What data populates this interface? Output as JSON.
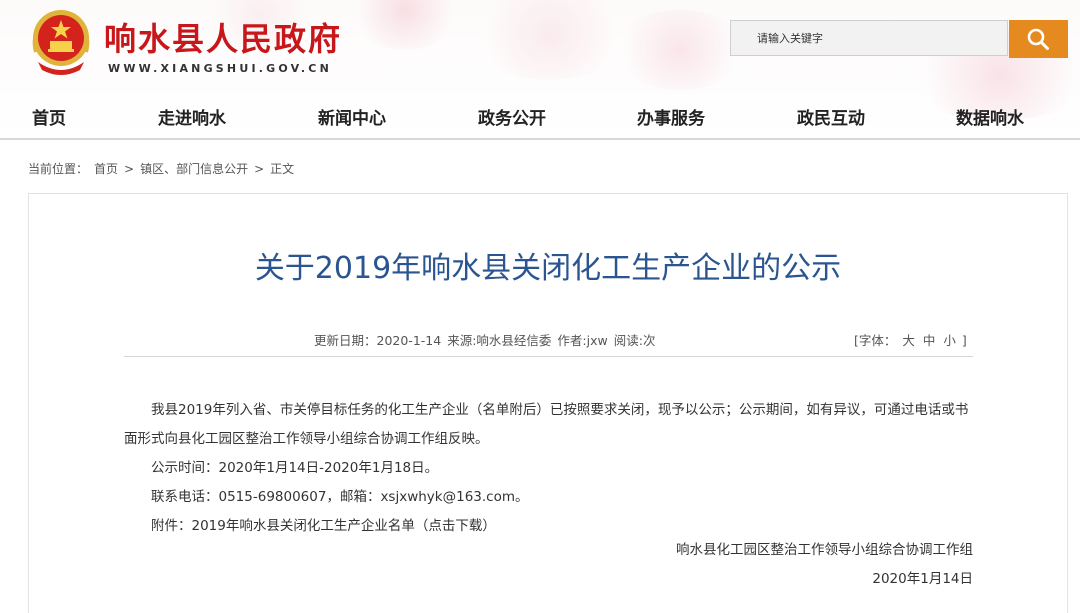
{
  "header": {
    "site_title": "响水县人民政府",
    "site_url": "WWW.XIANGSHUI.GOV.CN",
    "emblem_icon": "national-emblem-icon",
    "search": {
      "placeholder": "请输入关键字",
      "button_icon": "search-icon",
      "button_color": "#e58a1f"
    }
  },
  "nav": {
    "items": [
      {
        "label": "首页"
      },
      {
        "label": "走进响水"
      },
      {
        "label": "新闻中心"
      },
      {
        "label": "政务公开"
      },
      {
        "label": "办事服务"
      },
      {
        "label": "政民互动"
      },
      {
        "label": "数据响水"
      }
    ]
  },
  "breadcrumb": {
    "prefix": "当前位置：",
    "items": [
      "首页",
      "镇区、部门信息公开",
      "正文"
    ],
    "separator": ">"
  },
  "article": {
    "title": "关于2019年响水县关闭化工生产企业的公示",
    "title_color": "#2a5590",
    "meta": {
      "date": "更新日期：2020-1-14",
      "source": "来源:响水县经信委",
      "author": "作者:jxw",
      "reads": "阅读:次"
    },
    "font_size_control": {
      "prefix": "[字体：",
      "large": "大",
      "medium": "中",
      "small": "小",
      "suffix": "]"
    },
    "paragraphs": [
      "我县2019年列入省、市关停目标任务的化工生产企业（名单附后）已按照要求关闭，现予以公示；公示期间，如有异议，可通过电话或书面形式向县化工园区整治工作领导小组综合协调工作组反映。",
      "公示时间：2020年1月14日-2020年1月18日。",
      "联系电话：0515-69800607，邮箱：xsjxwhyk@163.com。"
    ],
    "attachment": "附件：2019年响水县关闭化工生产企业名单（点击下载）",
    "signature": {
      "organization": "响水县化工园区整治工作领导小组综合协调工作组",
      "date": "2020年1月14日"
    }
  }
}
